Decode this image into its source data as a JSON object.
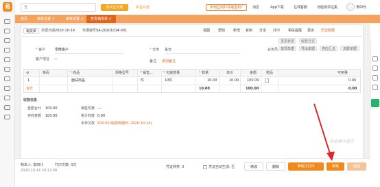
{
  "app": {
    "logo_text": "易"
  },
  "topbar": {
    "search_placeholder": "查",
    "btn_trial": "购买正式版",
    "btn_cert": "实名认证",
    "notice": "如何应用并快速盈利?",
    "links": [
      "消息",
      "App下载",
      "在线客服",
      "功能需求征集"
    ],
    "username": "李四代"
  },
  "tabs": [
    {
      "label": "首页"
    },
    {
      "label": "销货设置 ×"
    },
    {
      "label": "审核设置 ×"
    },
    {
      "label": "查看销货单 ×",
      "active": true
    }
  ],
  "doc": {
    "type_chip": "销货单",
    "date_label": "单据日期",
    "date": "2020-10-14",
    "no_label": "单据编号",
    "no": "SA-20201014-001",
    "tools": [
      "视图",
      "帮助",
      "新增",
      "复制",
      "分享",
      "打印",
      "相关提醒",
      "更多",
      "历史数据"
    ]
  },
  "form": {
    "customer_label": "客户",
    "customer": "零散客户",
    "warehouse_label": "仓库",
    "warehouse": "总仓",
    "salesperson_label": "业务员",
    "address_label": "客户地址",
    "address": "---",
    "remark_label": "备注",
    "remark_link": "添加备注",
    "right_buttons": [
      "单项单据",
      "导出单据",
      "供应汇总",
      "关联单据"
    ],
    "right_buttons_top": [
      "发票状态",
      "收款方式"
    ]
  },
  "table": {
    "headers": [
      "条码",
      "商品",
      "规格型号",
      "销售...",
      "包装数量",
      "数量",
      "单价",
      "金额",
      "赠品",
      "可用量"
    ],
    "rows": [
      {
        "idx": "1",
        "code": "",
        "product": "面试商品",
        "spec": "",
        "unit": "件",
        "pack": "10件",
        "qty": "10.00",
        "price": "10.00",
        "amount": "100.00",
        "gift": "",
        "avail": "0.00"
      }
    ],
    "total": {
      "label": "合计",
      "qty": "10.00",
      "amount": "100.00",
      "avail": "0.00"
    }
  },
  "collect": {
    "title": "收款信息",
    "amount_total_label": "金额合计",
    "amount_total": "100.00",
    "discount_label": "销售优惠",
    "discount": "---",
    "actual_label": "实收金额",
    "actual": "100.00",
    "cumulative_label": "累计收款",
    "cumulative": "0.00",
    "this_label": "本单欠款",
    "this_due": "100.00",
    "this_due_note": "(收款到期日: 2020-10-14)"
  },
  "footer": {
    "creator_label": "制单人",
    "creator": "李四代",
    "print_label": "打印次数",
    "print_count": "0次",
    "datetime": "2020-10-14 20:12:09",
    "voucher_label": "凭证种类",
    "voucher": "0",
    "auto_label": "凭证自动生成",
    "auto_val": "否",
    "buttons": {
      "edit": "修改",
      "delete": "删除",
      "audit_print": "审核并打印",
      "audit": "审核",
      "reject": "驳回"
    }
  },
  "watermark": "系统操作演示"
}
